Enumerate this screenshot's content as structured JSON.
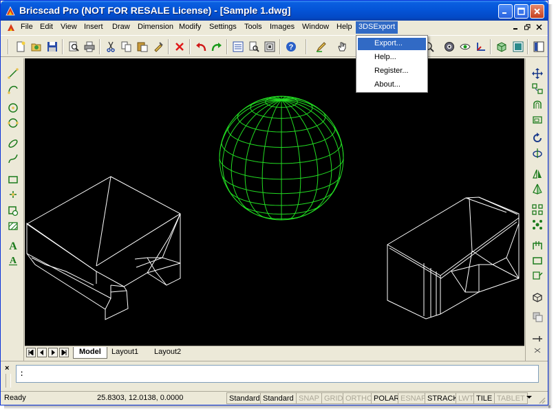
{
  "window": {
    "title": "Bricscad Pro (NOT FOR RESALE License) - [Sample 1.dwg]"
  },
  "menu": {
    "items": [
      "File",
      "Edit",
      "View",
      "Insert",
      "Draw",
      "Dimension",
      "Modify",
      "Settings",
      "Tools",
      "Images",
      "Window",
      "Help",
      "3DSExport"
    ],
    "active": "3DSExport"
  },
  "dropdown": {
    "items": [
      "Export...",
      "Help...",
      "Register...",
      "About..."
    ],
    "highlighted": "Export..."
  },
  "toolbar": {
    "icons": [
      "new-icon",
      "open-icon",
      "save-icon",
      "print-preview-icon",
      "print-icon",
      "cut-icon",
      "copy-icon",
      "paste-icon",
      "match-properties-icon",
      "delete-icon",
      "undo-icon",
      "redo-icon",
      "properties-icon",
      "explorer-icon",
      "design-center-icon",
      "help-icon",
      "pencil-icon",
      "pan-icon",
      "zoom-icon",
      "render-icon",
      "view-icon",
      "ucs-icon",
      "box-icon",
      "layout-icon"
    ]
  },
  "left_toolbar": {
    "icons": [
      "line-icon",
      "arc-icon",
      "circle-icon",
      "circle-3p-icon",
      "ellipse-icon",
      "spline-icon",
      "rectangle-icon",
      "point-icon",
      "insert-block-icon",
      "hatch-icon",
      "text-icon",
      "mtext-icon"
    ]
  },
  "right_toolbar": {
    "icons": [
      "move-icon",
      "copy-object-icon",
      "offset-icon",
      "scale-icon",
      "rotate-icon",
      "rotate-3d-icon",
      "mirror-icon",
      "mirror-3d-icon",
      "array-icon",
      "explode-icon",
      "trim-icon",
      "extend-icon",
      "stretch-icon",
      "solid-icon",
      "region-icon",
      "chamfer-icon"
    ]
  },
  "layout_tabs": {
    "tabs": [
      "Model",
      "Layout1",
      "Layout2"
    ],
    "active": "Model"
  },
  "command": {
    "prompt": ":"
  },
  "status": {
    "ready": "Ready",
    "coords": "25.8303, 12.0138, 0.0000",
    "buttons": [
      {
        "label": "Standard",
        "on": true
      },
      {
        "label": "Standard",
        "on": true
      },
      {
        "label": "SNAP",
        "on": false
      },
      {
        "label": "GRID",
        "on": false
      },
      {
        "label": "ORTHO",
        "on": false
      },
      {
        "label": "POLAR",
        "on": true
      },
      {
        "label": "ESNAP",
        "on": false
      },
      {
        "label": "STRACK",
        "on": true
      },
      {
        "label": "LWT",
        "on": false
      },
      {
        "label": "TILE",
        "on": true
      },
      {
        "label": "TABLET",
        "on": false
      }
    ]
  },
  "colors": {
    "title_bar": "#0453d6",
    "menu_highlight": "#316ac5",
    "canvas": "#000000",
    "sphere": "#22dd22",
    "wire": "#ffffff"
  }
}
